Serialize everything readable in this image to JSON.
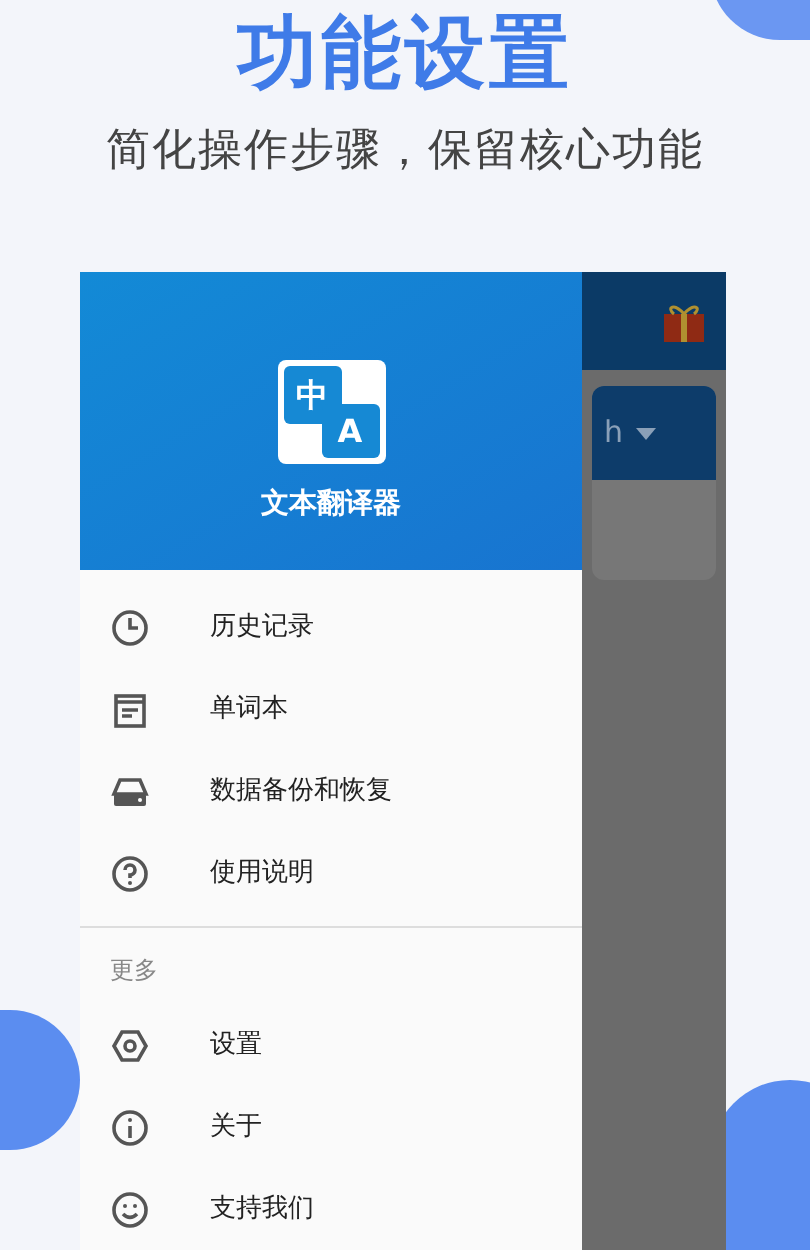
{
  "headline": "功能设置",
  "subtitle": "简化操作步骤，保留核心功能",
  "drawer": {
    "app_name": "文本翻译器",
    "logo": {
      "glyph_1": "中",
      "glyph_2": "A"
    },
    "items": [
      {
        "label": "历史记录"
      },
      {
        "label": "单词本"
      },
      {
        "label": "数据备份和恢复"
      },
      {
        "label": "使用说明"
      }
    ],
    "section_title": "更多",
    "more_items": [
      {
        "label": "设置"
      },
      {
        "label": "关于"
      },
      {
        "label": "支持我们"
      }
    ]
  },
  "behind": {
    "language_fragment": "h"
  }
}
